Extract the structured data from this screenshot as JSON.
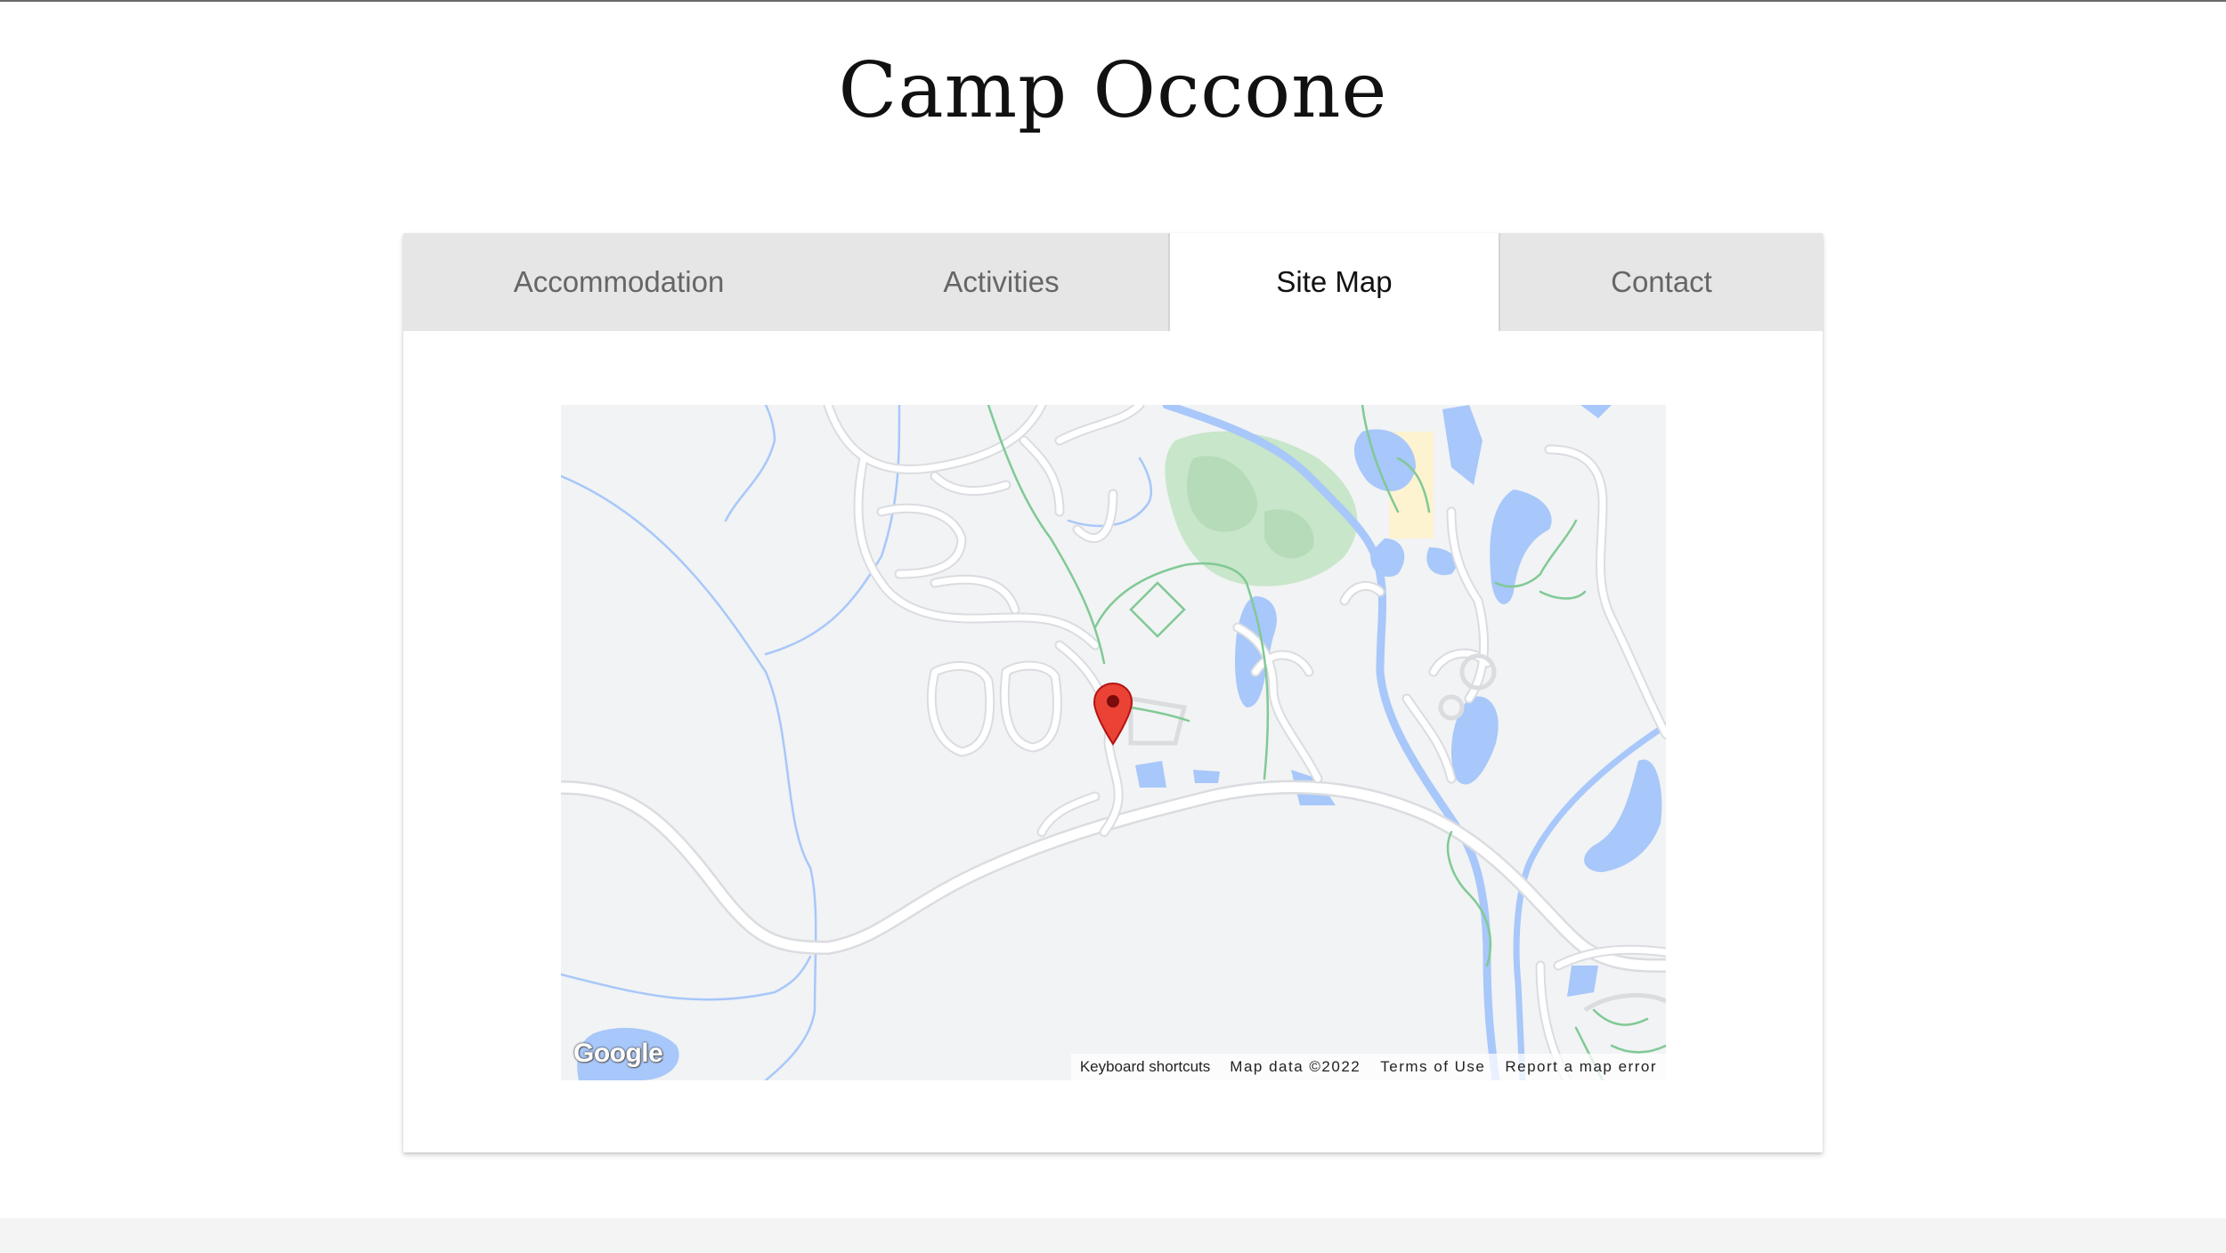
{
  "site": {
    "title": "Camp Occone"
  },
  "tabs": [
    {
      "label": "Accommodation",
      "active": false
    },
    {
      "label": "Activities",
      "active": false
    },
    {
      "label": "Site Map",
      "active": true
    },
    {
      "label": "Contact",
      "active": false
    }
  ],
  "map": {
    "provider_logo": "Google",
    "attribution": {
      "keyboard_shortcuts": "Keyboard shortcuts",
      "map_data": "Map data ©2022",
      "terms": "Terms of Use",
      "report": "Report a map error"
    },
    "marker_icon": "map-pin-icon",
    "colors": {
      "land": "#f1f3f4",
      "water": "#a8c7fa",
      "park": "#c8e6c9",
      "road": "#ffffff",
      "road_outline": "#dadce0",
      "trail": "#81c995",
      "building": "#fdf3d0",
      "marker": "#ea4335"
    }
  },
  "colors": {
    "tab_inactive_bg": "#e6e6e6",
    "tab_inactive_text": "#666666",
    "tab_active_text": "#111111",
    "footer_band": "#f4f4f4"
  }
}
